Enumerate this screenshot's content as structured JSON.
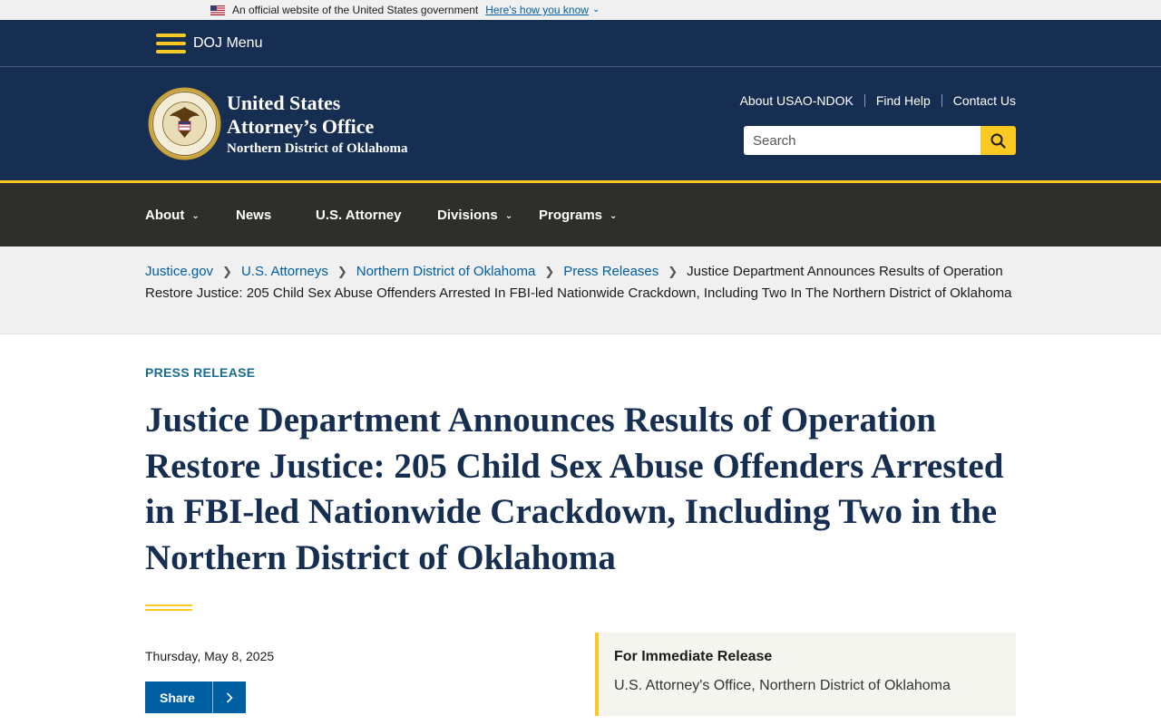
{
  "gov_banner": {
    "text": "An official website of the United States government",
    "link": "Here's how you know"
  },
  "doj_menu": {
    "label": "DOJ Menu"
  },
  "header": {
    "office_line1": "United States",
    "office_line2": "Attorney’s Office",
    "office_line3": "Northern District of Oklahoma",
    "util_links": [
      "About USAO-NDOK",
      "Find Help",
      "Contact Us"
    ],
    "search_placeholder": "Search"
  },
  "nav": {
    "items": [
      "About",
      "News",
      "U.S. Attorney",
      "Divisions",
      "Programs"
    ]
  },
  "breadcrumb": {
    "links": [
      "Justice.gov",
      "U.S. Attorneys",
      "Northern District of Oklahoma",
      "Press Releases"
    ],
    "current": "Justice Department Announces Results of Operation Restore Justice: 205 Child Sex Abuse Offenders Arrested In FBI-led Nationwide Crackdown, Including Two In The Northern District of Oklahoma"
  },
  "article": {
    "kicker": "PRESS RELEASE",
    "title": "Justice Department Announces Results of Operation Restore Justice: 205 Child Sex Abuse Offenders Arrested in FBI-led Nationwide Crackdown, Including Two in the Northern District of Oklahoma",
    "date": "Thursday, May 8, 2025",
    "share_label": "Share",
    "release_heading": "For Immediate Release",
    "release_source": "U.S. Attorney's Office, Northern District of Oklahoma"
  },
  "colors": {
    "navy": "#162e51",
    "gold": "#fac922",
    "nav_dark": "#2e2e2a",
    "link_blue": "#005ea2",
    "kicker_teal": "#1a6c8f"
  }
}
